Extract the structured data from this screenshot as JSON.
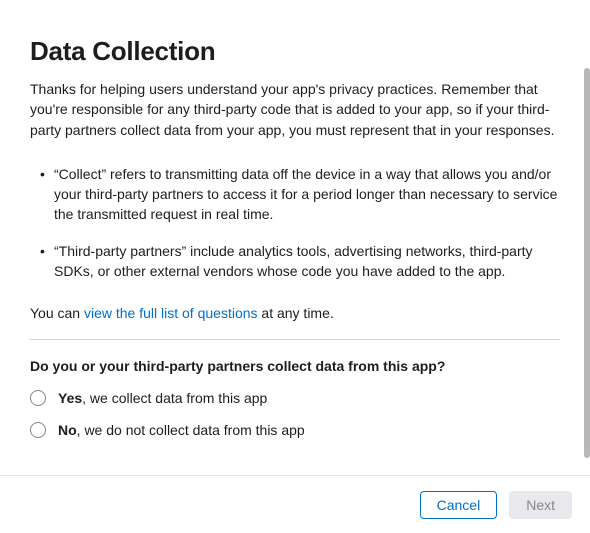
{
  "title": "Data Collection",
  "intro": "Thanks for helping users understand your app's privacy practices. Remember that you're responsible for any third-party code that is added to your app, so if your third-party partners collect data from your app, you must represent that in your responses.",
  "bullets": [
    "“Collect” refers to transmitting data off the device in a way that allows you and/or your third-party partners to access it for a period longer than necessary to service the transmitted request in real time.",
    "“Third-party partners” include analytics tools, advertising networks, third-party SDKs, or other external vendors whose code you have added to the app."
  ],
  "link_row": {
    "prefix": "You can ",
    "link_text": "view the full list of questions",
    "suffix": " at any time."
  },
  "question": "Do you or your third-party partners collect data from this app?",
  "options": [
    {
      "bold": "Yes",
      "rest": ", we collect data from this app"
    },
    {
      "bold": "No",
      "rest": ", we do not collect data from this app"
    }
  ],
  "footer": {
    "cancel": "Cancel",
    "next": "Next"
  }
}
